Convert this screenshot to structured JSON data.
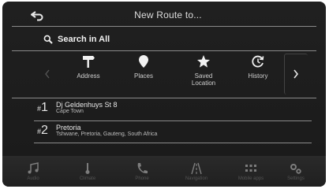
{
  "header": {
    "title": "New Route to..."
  },
  "search": {
    "label": "Search in All"
  },
  "categories": [
    {
      "label": "Address",
      "icon": "signpost-icon"
    },
    {
      "label": "Places",
      "icon": "location-pin-icon"
    },
    {
      "label": "Saved\nLocation",
      "icon": "star-icon"
    },
    {
      "label": "History",
      "icon": "history-icon"
    }
  ],
  "history": [
    {
      "index": "1",
      "title": "Dj Geldenhuys St 8",
      "subtitle": "Cape Town"
    },
    {
      "index": "2",
      "title": "Pretoria",
      "subtitle": "Tshwane, Pretoria, Gauteng, South Africa"
    }
  ],
  "bottom_tabs": [
    {
      "label": "Audio",
      "icon": "music-note-icon"
    },
    {
      "label": "Climate",
      "icon": "thermometer-icon"
    },
    {
      "label": "Phone",
      "icon": "phone-icon"
    },
    {
      "label": "Navigation",
      "icon": "navigation-road-icon"
    },
    {
      "label": "Mobile apps",
      "icon": "apps-grid-icon"
    },
    {
      "label": "Settings",
      "icon": "gears-icon"
    }
  ]
}
